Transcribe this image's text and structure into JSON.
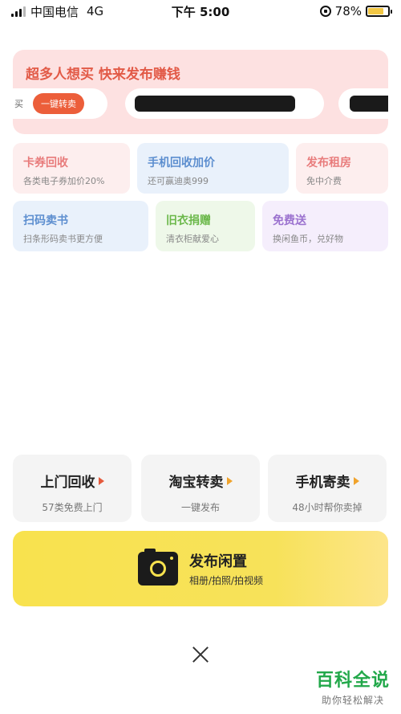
{
  "status_bar": {
    "carrier": "中国电信",
    "network": "4G",
    "time": "下午 5:00",
    "battery_percent": "78%",
    "battery_level": 0.78
  },
  "promo": {
    "title": "超多人想买 快来发布赚钱",
    "chip1_text": "买",
    "chip1_button": "一键转卖"
  },
  "services": [
    {
      "title": "卡券回收",
      "sub": "各类电子券加价20%"
    },
    {
      "title": "手机回收加价",
      "sub": "还可赢迪奥999"
    },
    {
      "title": "发布租房",
      "sub": "免中介费"
    },
    {
      "title": "扫码卖书",
      "sub": "扫条形码卖书更方便"
    },
    {
      "title": "旧衣捐赠",
      "sub": "清衣柜献爱心"
    },
    {
      "title": "免费送",
      "sub": "换闲鱼币，兑好物"
    }
  ],
  "actions": [
    {
      "title": "上门回收",
      "sub": "57类免费上门"
    },
    {
      "title": "淘宝转卖",
      "sub": "一键发布"
    },
    {
      "title": "手机寄卖",
      "sub": "48小时帮你卖掉"
    }
  ],
  "publish": {
    "title": "发布闲置",
    "sub": "相册/拍照/拍视频"
  },
  "watermark": {
    "title": "百科全说",
    "sub": "助你轻松解决"
  },
  "colors": {
    "accent_yellow": "#f8e24e",
    "promo_red": "#e25a47",
    "button_orange": "#ec5e3a",
    "watermark_green": "#22a84a"
  }
}
